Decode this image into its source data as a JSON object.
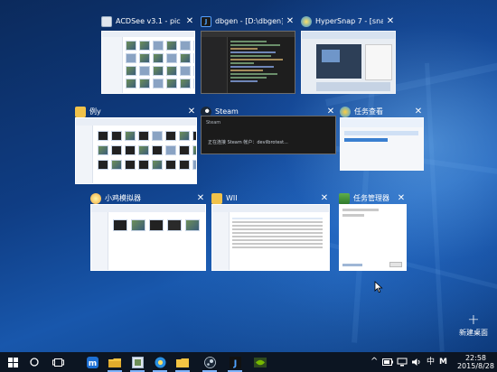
{
  "windows": [
    {
      "title": "ACDSee v3.1 - pic",
      "icon": "acdsee-icon",
      "close": "✕"
    },
    {
      "title": "dbgen - [D:\\dbgen] - ...",
      "icon": "jetbrains-icon",
      "close": "✕"
    },
    {
      "title": "HyperSnap 7 - [snap0...",
      "icon": "hypersnap-icon",
      "close": "✕"
    },
    {
      "title": "例y",
      "icon": "folder-icon",
      "close": "✕"
    },
    {
      "title": "Steam",
      "icon": "steam-icon",
      "close": "✕",
      "thumb_title": "Steam",
      "thumb_message": "正在连接 Steam 帐户：devilbrotest..."
    },
    {
      "title": "任务查看",
      "icon": "task-view-app-icon",
      "close": "✕"
    },
    {
      "title": "小鸡模拟器",
      "icon": "emulator-icon",
      "close": "✕"
    },
    {
      "title": "WII",
      "icon": "folder-icon",
      "close": "✕"
    },
    {
      "title": "任务管理器",
      "icon": "task-manager-icon",
      "close": "✕"
    }
  ],
  "new_desktop": {
    "label": "新建桌面",
    "icon": "plus-icon"
  },
  "taskbar": {
    "start_icon": "windows-logo-icon",
    "search_icon": "cortana-icon",
    "taskview_icon": "task-view-icon",
    "apps": [
      "maxthon-icon",
      "file-explorer-icon",
      "acdsee-icon",
      "hypersnap-icon",
      "folder-icon",
      "steam-icon",
      "jetbrains-icon",
      "nvidia-icon"
    ],
    "tray": {
      "chevron": "^",
      "ime": "中",
      "ime_mode": "M"
    },
    "clock": {
      "time": "22:58",
      "date": "2015/8/28"
    }
  },
  "colors": {
    "taskbar": "#0c1522",
    "accent": "#7fb4ff"
  }
}
